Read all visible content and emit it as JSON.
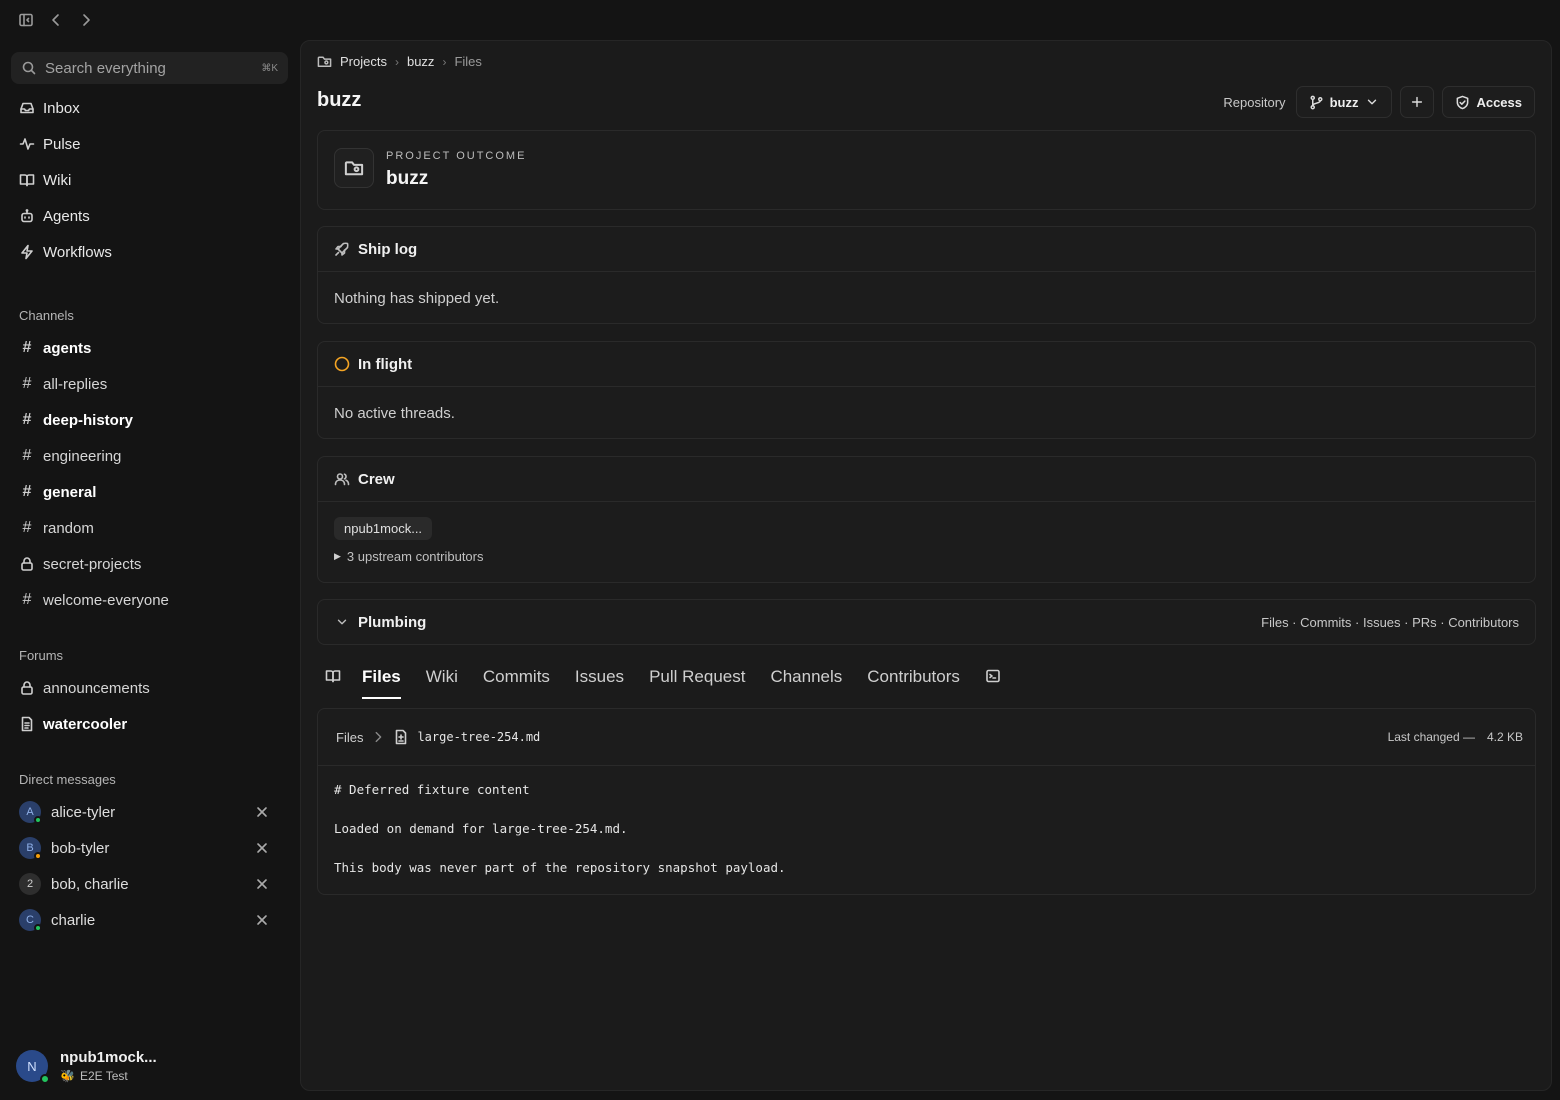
{
  "topbar": {
    "icons": [
      "sidebar-toggle-icon",
      "back-arrow-icon",
      "forward-arrow-icon"
    ]
  },
  "sidebar": {
    "search": {
      "placeholder": "Search everything",
      "shortcut": "⌘K"
    },
    "nav": [
      {
        "label": "Inbox",
        "icon": "inbox-icon"
      },
      {
        "label": "Pulse",
        "icon": "pulse-icon"
      },
      {
        "label": "Wiki",
        "icon": "book-icon"
      },
      {
        "label": "Agents",
        "icon": "robot-icon"
      },
      {
        "label": "Workflows",
        "icon": "lightning-icon"
      }
    ],
    "channels_title": "Channels",
    "channels": [
      {
        "label": "agents",
        "unread": true,
        "type": "public"
      },
      {
        "label": "all-replies",
        "unread": false,
        "type": "public"
      },
      {
        "label": "deep-history",
        "unread": true,
        "type": "public"
      },
      {
        "label": "engineering",
        "unread": false,
        "type": "public"
      },
      {
        "label": "general",
        "unread": true,
        "type": "public"
      },
      {
        "label": "random",
        "unread": false,
        "type": "public"
      },
      {
        "label": "secret-projects",
        "unread": false,
        "type": "private"
      },
      {
        "label": "welcome-everyone",
        "unread": false,
        "type": "public"
      }
    ],
    "forums_title": "Forums",
    "forums": [
      {
        "label": "announcements",
        "unread": false,
        "icon": "lock-icon"
      },
      {
        "label": "watercooler",
        "unread": true,
        "icon": "document-icon"
      }
    ],
    "dms_title": "Direct messages",
    "dms": [
      {
        "label": "alice-tyler",
        "initial": "A",
        "status_color": "#22c55e"
      },
      {
        "label": "bob-tyler",
        "initial": "B",
        "status_color": "#f59e0b"
      },
      {
        "label": "bob, charlie",
        "initial": "2",
        "status_color": ""
      },
      {
        "label": "charlie",
        "initial": "C",
        "status_color": "#22c55e"
      }
    ],
    "user": {
      "initial": "N",
      "name": "npub1mock...",
      "status_emoji": "🐝",
      "status": "E2E Test",
      "online_color": "#22c55e"
    }
  },
  "main": {
    "breadcrumb": {
      "root": "Projects",
      "project": "buzz",
      "current": "Files"
    },
    "title": "buzz",
    "actions": {
      "repository": "Repository",
      "branch": "buzz",
      "access": "Access"
    },
    "outcome": {
      "label": "PROJECT OUTCOME",
      "value": "buzz"
    },
    "ship_log": {
      "title": "Ship log",
      "empty": "Nothing has shipped yet."
    },
    "in_flight": {
      "title": "In flight",
      "empty": "No active threads.",
      "status_color": "#f5a524"
    },
    "crew": {
      "title": "Crew",
      "member": "npub1mock...",
      "upstream": "3 upstream contributors"
    },
    "plumbing": {
      "title": "Plumbing",
      "links": "Files · Commits · Issues · PRs · Contributors"
    },
    "tabs": [
      "Files",
      "Wiki",
      "Commits",
      "Issues",
      "Pull Request",
      "Channels",
      "Contributors"
    ],
    "active_tab": "Files",
    "file": {
      "root": "Files",
      "name": "large-tree-254.md",
      "last_changed": "Last changed —",
      "size": "4.2 KB",
      "lines": [
        "# Deferred fixture content",
        "Loaded on demand for large-tree-254.md.",
        "This body was never part of the repository snapshot payload."
      ]
    }
  }
}
